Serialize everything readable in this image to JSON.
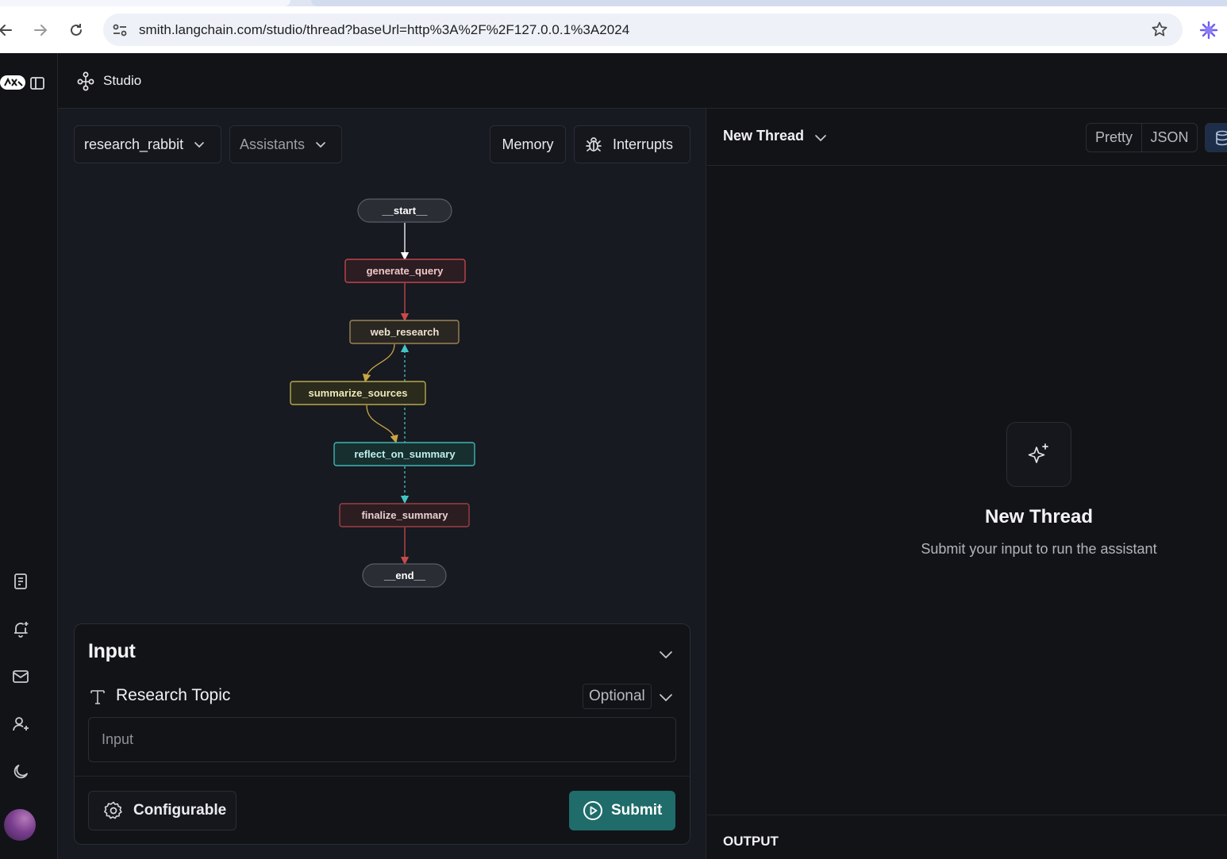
{
  "browser": {
    "url": "smith.langchain.com/studio/thread?baseUrl=http%3A%2F%2F127.0.0.1%3A2024"
  },
  "header": {
    "studio_label": "Studio"
  },
  "toolbar": {
    "graph_select": "research_rabbit",
    "assistants_select": "Assistants",
    "memory_label": "Memory",
    "interrupts_label": "Interrupts"
  },
  "graph": {
    "nodes": [
      {
        "id": "start",
        "label": "__start__",
        "color": "#3a3d46"
      },
      {
        "id": "generate_query",
        "label": "generate_query",
        "color": "#c0444b"
      },
      {
        "id": "web_research",
        "label": "web_research",
        "color": "#9a8358"
      },
      {
        "id": "summarize_sources",
        "label": "summarize_sources",
        "color": "#b7a84b"
      },
      {
        "id": "reflect_on_summary",
        "label": "reflect_on_summary",
        "color": "#3fb5b5"
      },
      {
        "id": "finalize_summary",
        "label": "finalize_summary",
        "color": "#9c3f46"
      },
      {
        "id": "end",
        "label": "__end__",
        "color": "#3a3d46"
      }
    ]
  },
  "input_panel": {
    "title": "Input",
    "field_label": "Research Topic",
    "field_badge": "Optional",
    "field_placeholder": "Input",
    "configurable_label": "Configurable",
    "submit_label": "Submit"
  },
  "thread": {
    "title": "New Thread",
    "view_pretty": "Pretty",
    "view_json": "JSON",
    "empty_title": "New Thread",
    "empty_subtitle": "Submit your input to run the assistant",
    "output_label": "OUTPUT"
  },
  "colors": {
    "accent_submit": "#1f6c6a",
    "background": "#121317",
    "graph_background": "#171a21"
  }
}
